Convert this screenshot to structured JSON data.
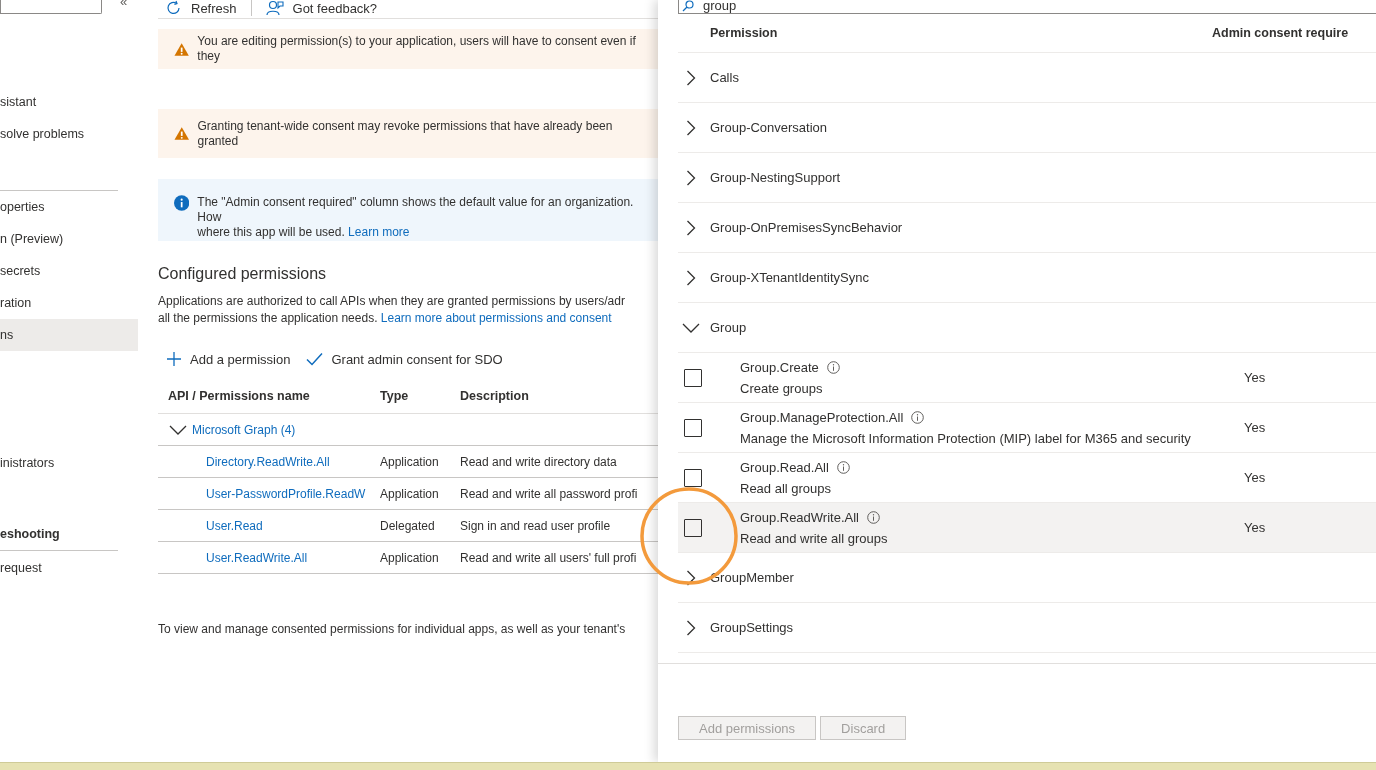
{
  "sidebar": {
    "collapse": "«",
    "items": [
      {
        "kind": "item",
        "label": "sistant",
        "selected": false
      },
      {
        "kind": "item",
        "label": "solve problems",
        "selected": false
      },
      {
        "kind": "divider"
      },
      {
        "kind": "item",
        "label": "operties",
        "selected": false
      },
      {
        "kind": "item",
        "label": "n (Preview)",
        "selected": false
      },
      {
        "kind": "item",
        "label": "secrets",
        "selected": false
      },
      {
        "kind": "item",
        "label": "ration",
        "selected": false
      },
      {
        "kind": "item",
        "label": "ns",
        "selected": true
      },
      {
        "kind": "item",
        "label": "inistrators",
        "selected": false
      },
      {
        "kind": "heading",
        "label": "eshooting"
      },
      {
        "kind": "divider"
      },
      {
        "kind": "item",
        "label": "request",
        "selected": false
      }
    ]
  },
  "toolbar": [
    {
      "kind": "refresh",
      "label": "Refresh"
    },
    {
      "kind": "feedback",
      "label": "Got feedback?"
    }
  ],
  "alerts": [
    {
      "kind": "warning",
      "lines": [
        "You are editing permission(s) to your application, users will have to consent even if they"
      ]
    },
    {
      "kind": "warning",
      "lines": [
        "Granting tenant-wide consent may revoke permissions that have already been granted"
      ]
    },
    {
      "kind": "info",
      "lines": [
        "The \"Admin consent required\" column shows the default value for an organization. How",
        "where this app will be used."
      ],
      "link": "Learn more"
    }
  ],
  "configured": {
    "title": "Configured permissions",
    "lines": [
      "Applications are authorized to call APIs when they are granted permissions by users/adr",
      "all the permissions the application needs."
    ],
    "link": "Learn more about permissions and consent",
    "actions": [
      {
        "kind": "add",
        "label": "Add a permission"
      },
      {
        "kind": "grant",
        "label": "Grant admin consent for SDO"
      }
    ],
    "columns": [
      "API / Permissions name",
      "Type",
      "Description"
    ],
    "api": {
      "label": "Microsoft Graph (4)",
      "expanded": true
    },
    "rows": [
      {
        "name": "Directory.ReadWrite.All",
        "type": "Application",
        "description": "Read and write directory data"
      },
      {
        "name": "User-PasswordProfile.ReadW",
        "type": "Application",
        "description": "Read and write all password profi"
      },
      {
        "name": "User.Read",
        "type": "Delegated",
        "description": "Sign in and read user profile"
      },
      {
        "name": "User.ReadWrite.All",
        "type": "Application",
        "description": "Read and write all users' full profi"
      }
    ],
    "footer": "To view and manage consented permissions for individual apps, as well as your tenant's"
  },
  "panel": {
    "search": {
      "value": "group"
    },
    "columns": [
      "Permission",
      "Admin consent require"
    ],
    "groups": [
      {
        "name": "Calls",
        "expanded": false
      },
      {
        "name": "Group-Conversation",
        "expanded": false
      },
      {
        "name": "Group-NestingSupport",
        "expanded": false
      },
      {
        "name": "Group-OnPremisesSyncBehavior",
        "expanded": false
      },
      {
        "name": "Group-XTenantIdentitySync",
        "expanded": false
      },
      {
        "name": "Group",
        "expanded": true,
        "children": [
          {
            "name": "Group.Create",
            "description": "Create groups",
            "admin": "Yes",
            "checked": false,
            "selected": false
          },
          {
            "name": "Group.ManageProtection.All",
            "description": "Manage the Microsoft Information Protection (MIP) label for M365 and security",
            "admin": "Yes",
            "checked": false,
            "selected": false
          },
          {
            "name": "Group.Read.All",
            "description": "Read all groups",
            "admin": "Yes",
            "checked": false,
            "selected": false
          },
          {
            "name": "Group.ReadWrite.All",
            "description": "Read and write all groups",
            "admin": "Yes",
            "checked": false,
            "selected": true
          }
        ]
      },
      {
        "name": "GroupMember",
        "expanded": false
      },
      {
        "name": "GroupSettings",
        "expanded": false
      }
    ],
    "buttons": [
      {
        "label": "Add permissions",
        "disabled": true
      },
      {
        "label": "Discard",
        "disabled": true
      }
    ]
  },
  "annotation": {
    "kind": "circle"
  }
}
